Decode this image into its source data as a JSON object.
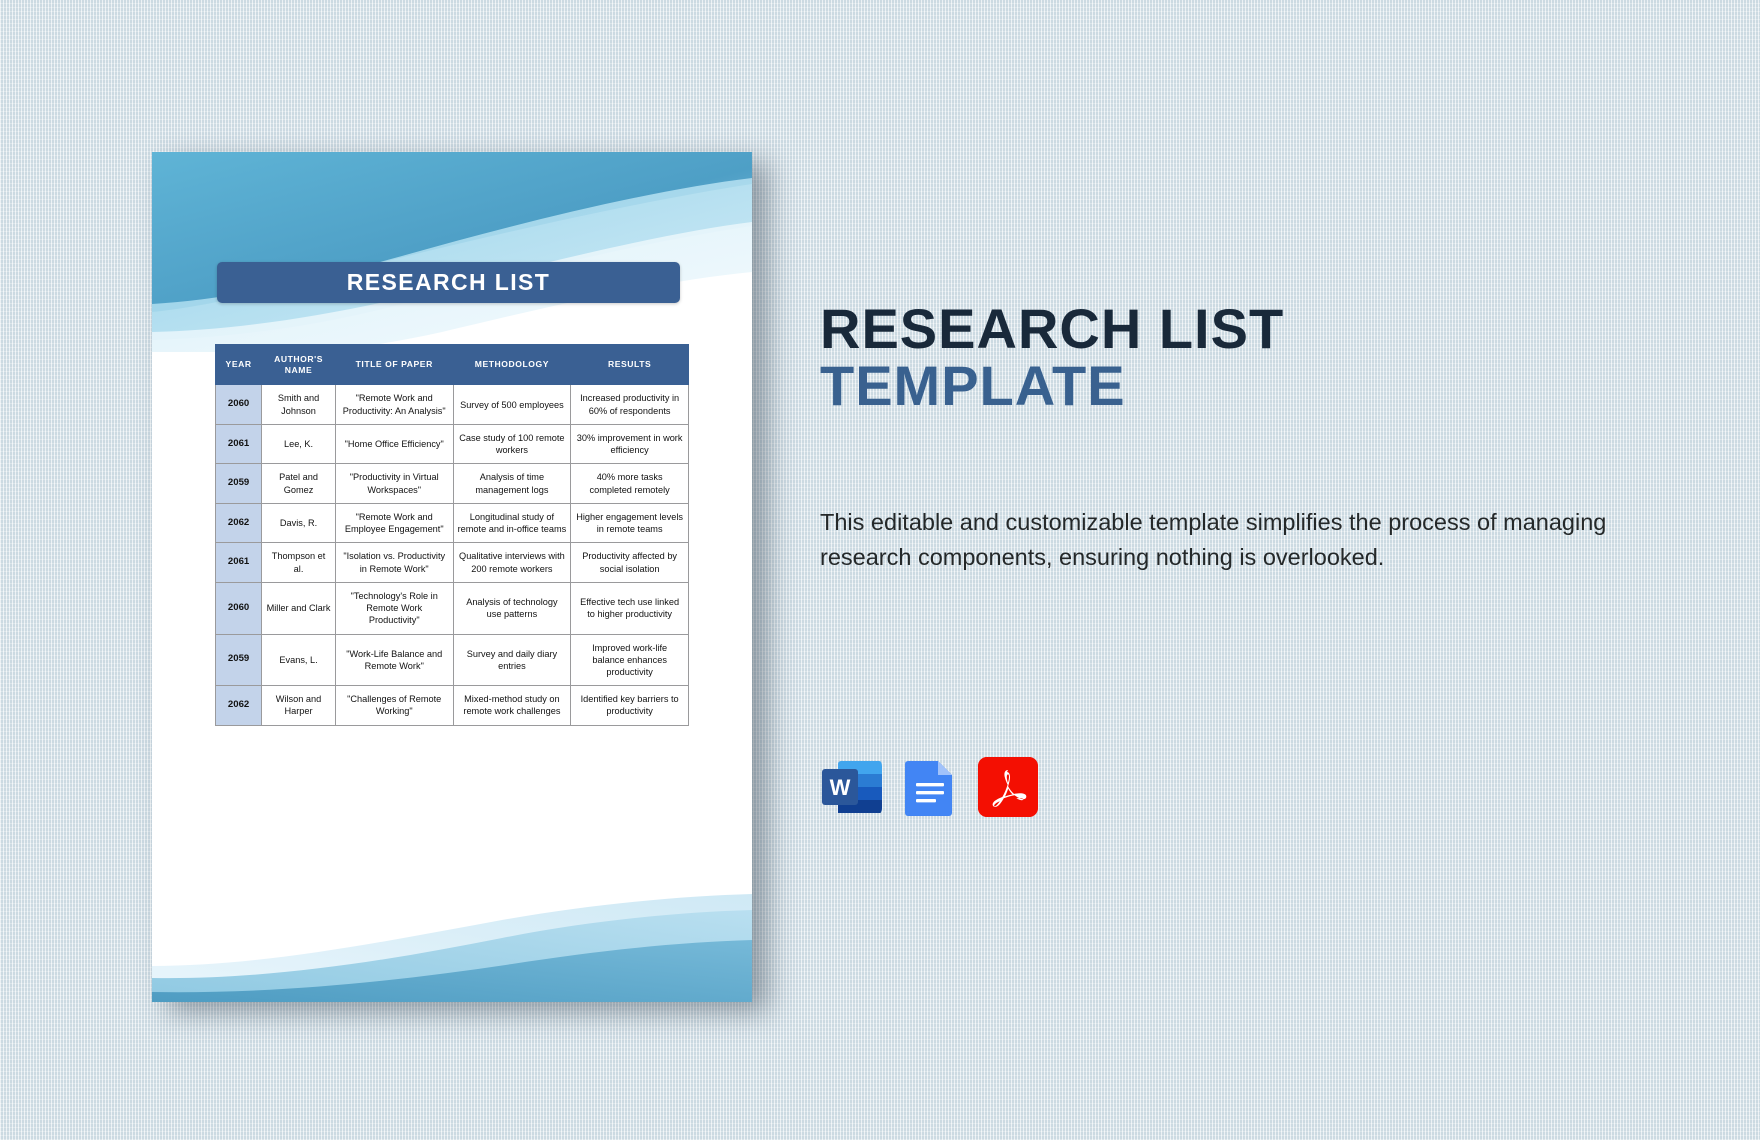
{
  "background": {
    "color": "#dbe7ed"
  },
  "document": {
    "title": "RESEARCH LIST",
    "banner_color": "#3a6093",
    "page_color": "#ffffff",
    "wave_colors": {
      "dark_blue": "#4ea3c8",
      "mid_blue": "#6cbedd",
      "light_blue": "#b9e0f0",
      "pale_blue": "#e8f5fb",
      "deep_blue": "#4a90b9"
    },
    "table": {
      "header_color": "#3a6093",
      "year_cell_color": "#c3d3ea",
      "columns": [
        "YEAR",
        "AUTHOR'S NAME",
        "TITLE OF PAPER",
        "METHODOLOGY",
        "RESULTS"
      ],
      "rows": [
        {
          "year": "2060",
          "author": "Smith and Johnson",
          "title": "\"Remote Work and Productivity: An Analysis\"",
          "methodology": "Survey of 500 employees",
          "results": "Increased productivity in 60% of respondents"
        },
        {
          "year": "2061",
          "author": "Lee, K.",
          "title": "\"Home Office Efficiency\"",
          "methodology": "Case study of 100 remote workers",
          "results": "30% improvement in work efficiency"
        },
        {
          "year": "2059",
          "author": "Patel and Gomez",
          "title": "\"Productivity in Virtual Workspaces\"",
          "methodology": "Analysis of time management logs",
          "results": "40% more tasks completed remotely"
        },
        {
          "year": "2062",
          "author": "Davis, R.",
          "title": "\"Remote Work and Employee Engagement\"",
          "methodology": "Longitudinal study of remote and in-office teams",
          "results": "Higher engagement levels in remote teams"
        },
        {
          "year": "2061",
          "author": "Thompson et al.",
          "title": "\"Isolation vs. Productivity in Remote Work\"",
          "methodology": "Qualitative interviews with 200 remote workers",
          "results": "Productivity affected by social isolation"
        },
        {
          "year": "2060",
          "author": "Miller and Clark",
          "title": "\"Technology's Role in Remote Work Productivity\"",
          "methodology": "Analysis of technology use patterns",
          "results": "Effective tech use linked to higher productivity"
        },
        {
          "year": "2059",
          "author": "Evans, L.",
          "title": "\"Work-Life Balance and Remote Work\"",
          "methodology": "Survey and daily diary entries",
          "results": "Improved work-life balance enhances productivity"
        },
        {
          "year": "2062",
          "author": "Wilson and Harper",
          "title": "\"Challenges of Remote Working\"",
          "methodology": "Mixed-method study on remote work challenges",
          "results": "Identified key barriers to productivity"
        }
      ]
    }
  },
  "promo": {
    "heading_line1": "RESEARCH LIST",
    "heading_line2": "TEMPLATE",
    "heading_line1_color": "#19293a",
    "heading_line2_color": "#39618f",
    "description": "This editable and customizable template simplifies the process of managing research components, ensuring nothing is overlooked."
  },
  "formats": [
    {
      "name": "word-icon",
      "label": "W",
      "color": "#2b579a"
    },
    {
      "name": "google-docs-icon",
      "label": "",
      "color": "#4285f4"
    },
    {
      "name": "pdf-icon",
      "label": "",
      "color": "#f40f02"
    }
  ]
}
